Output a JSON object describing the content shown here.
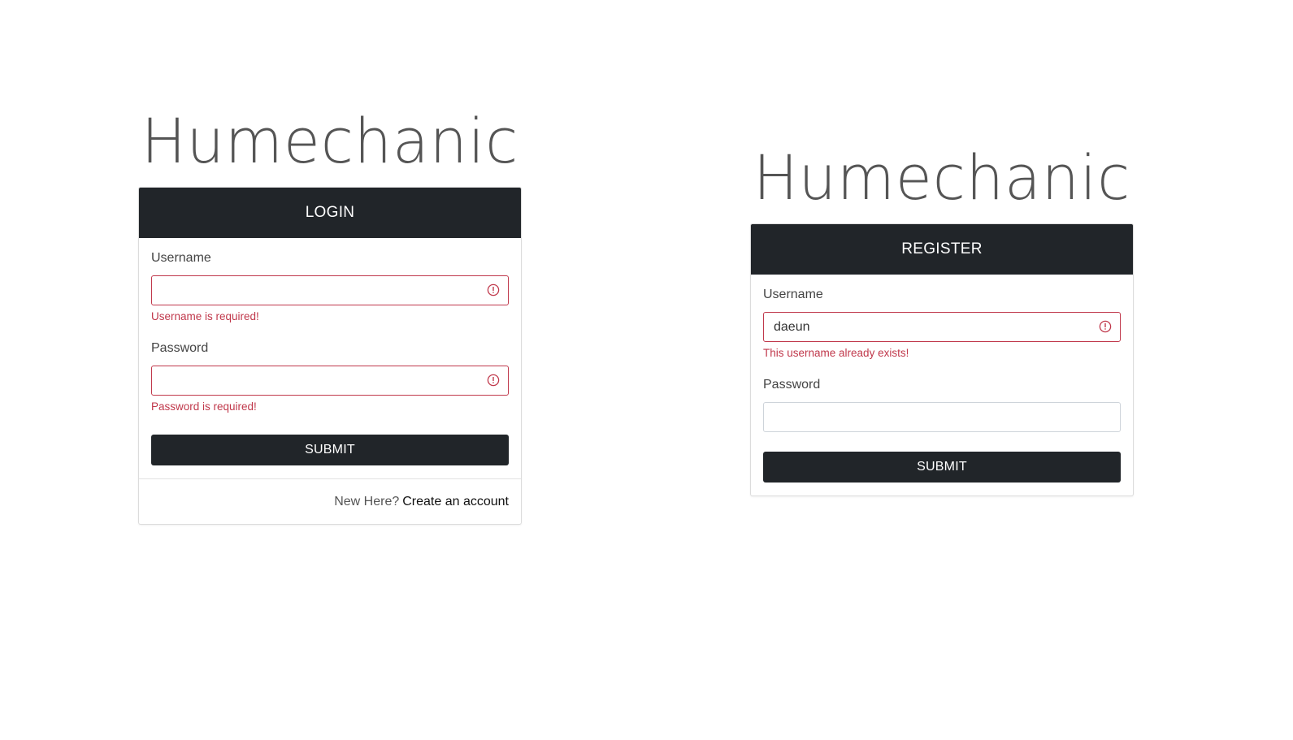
{
  "login": {
    "brand": "Humechanic",
    "header": "LOGIN",
    "username_label": "Username",
    "username_value": "",
    "username_error": "Username is required!",
    "password_label": "Password",
    "password_value": "",
    "password_error": "Password is required!",
    "submit_label": "SUBMIT",
    "footer_prefix": "New Here?",
    "footer_link": "Create an account"
  },
  "register": {
    "brand": "Humechanic",
    "header": "REGISTER",
    "username_label": "Username",
    "username_value": "daeun",
    "username_error": "This username already exists!",
    "password_label": "Password",
    "password_value": "",
    "submit_label": "SUBMIT"
  },
  "colors": {
    "header_bg": "#212529",
    "error": "#c0384b",
    "brand_text": "#555555"
  },
  "icons": {
    "validation": "exclamation-circle-icon"
  }
}
